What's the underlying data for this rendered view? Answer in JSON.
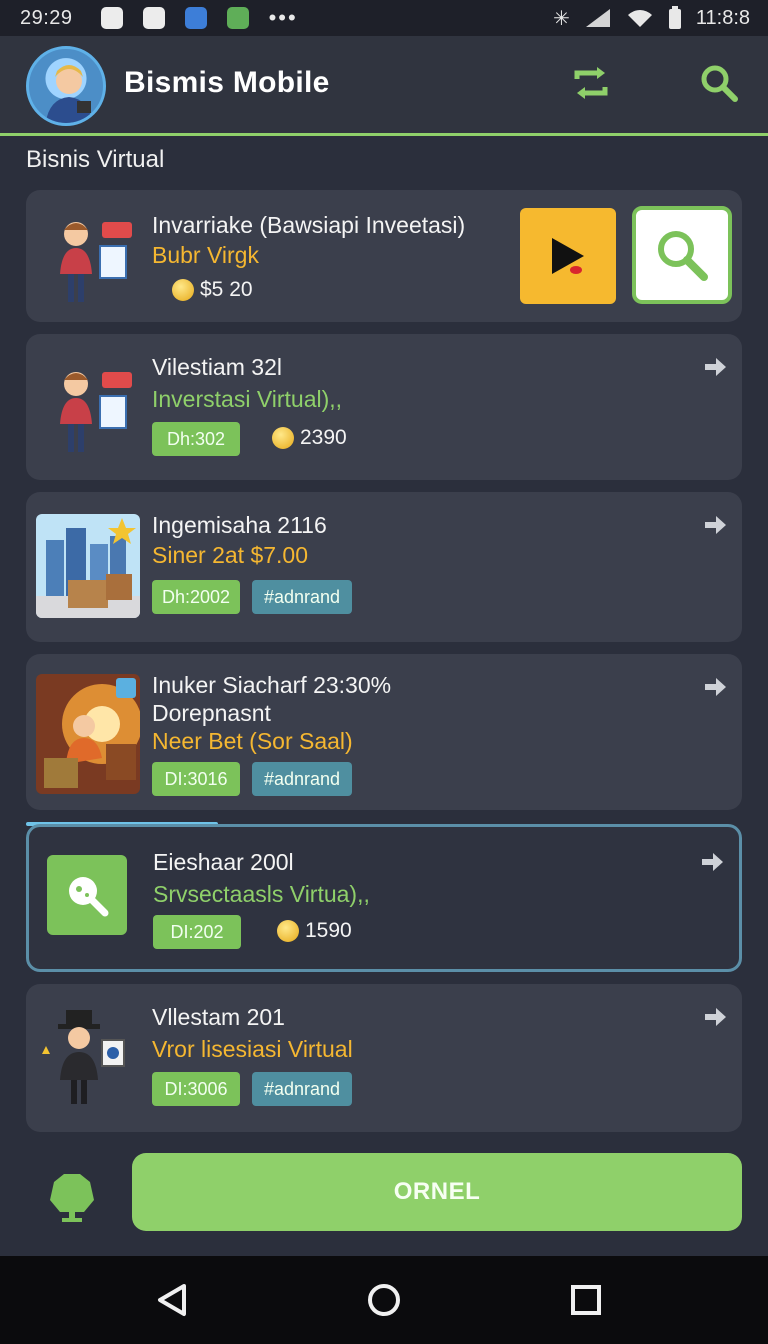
{
  "status_bar": {
    "time": "29:29",
    "clock": "11:8:8",
    "dots": "•••"
  },
  "app": {
    "title": "Bismis Mobile"
  },
  "section": {
    "title": "Bisnis Virtual"
  },
  "cards": [
    {
      "title": "Invarriake (Bawsiapi Inveetasi)",
      "subtitle": "Bubr Virgk",
      "coin_value": "$5 20"
    },
    {
      "title": "Vilestiam 32l",
      "subtitle": "Inverstasi Virtual),,",
      "badge": "Dh:302",
      "coin_value": "2390"
    },
    {
      "title": "Ingemisaha 2116",
      "subtitle": "Siner 2at $7.00",
      "badge": "Dh:2002",
      "tag": "#adnrand"
    },
    {
      "title": "Inuker Siacharf 23:30%",
      "line2": "Dorepnasnt",
      "subtitle": "Neer Bet (Sor Saal)",
      "badge": "DI:3016",
      "tag": "#adnrand"
    },
    {
      "title": "Eieshaar 200l",
      "subtitle": "Srvsectaasls Virtua),,",
      "badge": "DI:202",
      "coin_value": "1590"
    },
    {
      "title": "Vllestam 201",
      "subtitle": "Vror lisesiasi Virtual",
      "badge": "DI:3006",
      "tag": "#adnrand"
    }
  ],
  "actions": {
    "primary_label": "ORNEL"
  },
  "colors": {
    "accent_green": "#8fd06a",
    "accent_yellow": "#f5b731",
    "background": "#2b2f3c",
    "card": "#3b3f4c"
  }
}
